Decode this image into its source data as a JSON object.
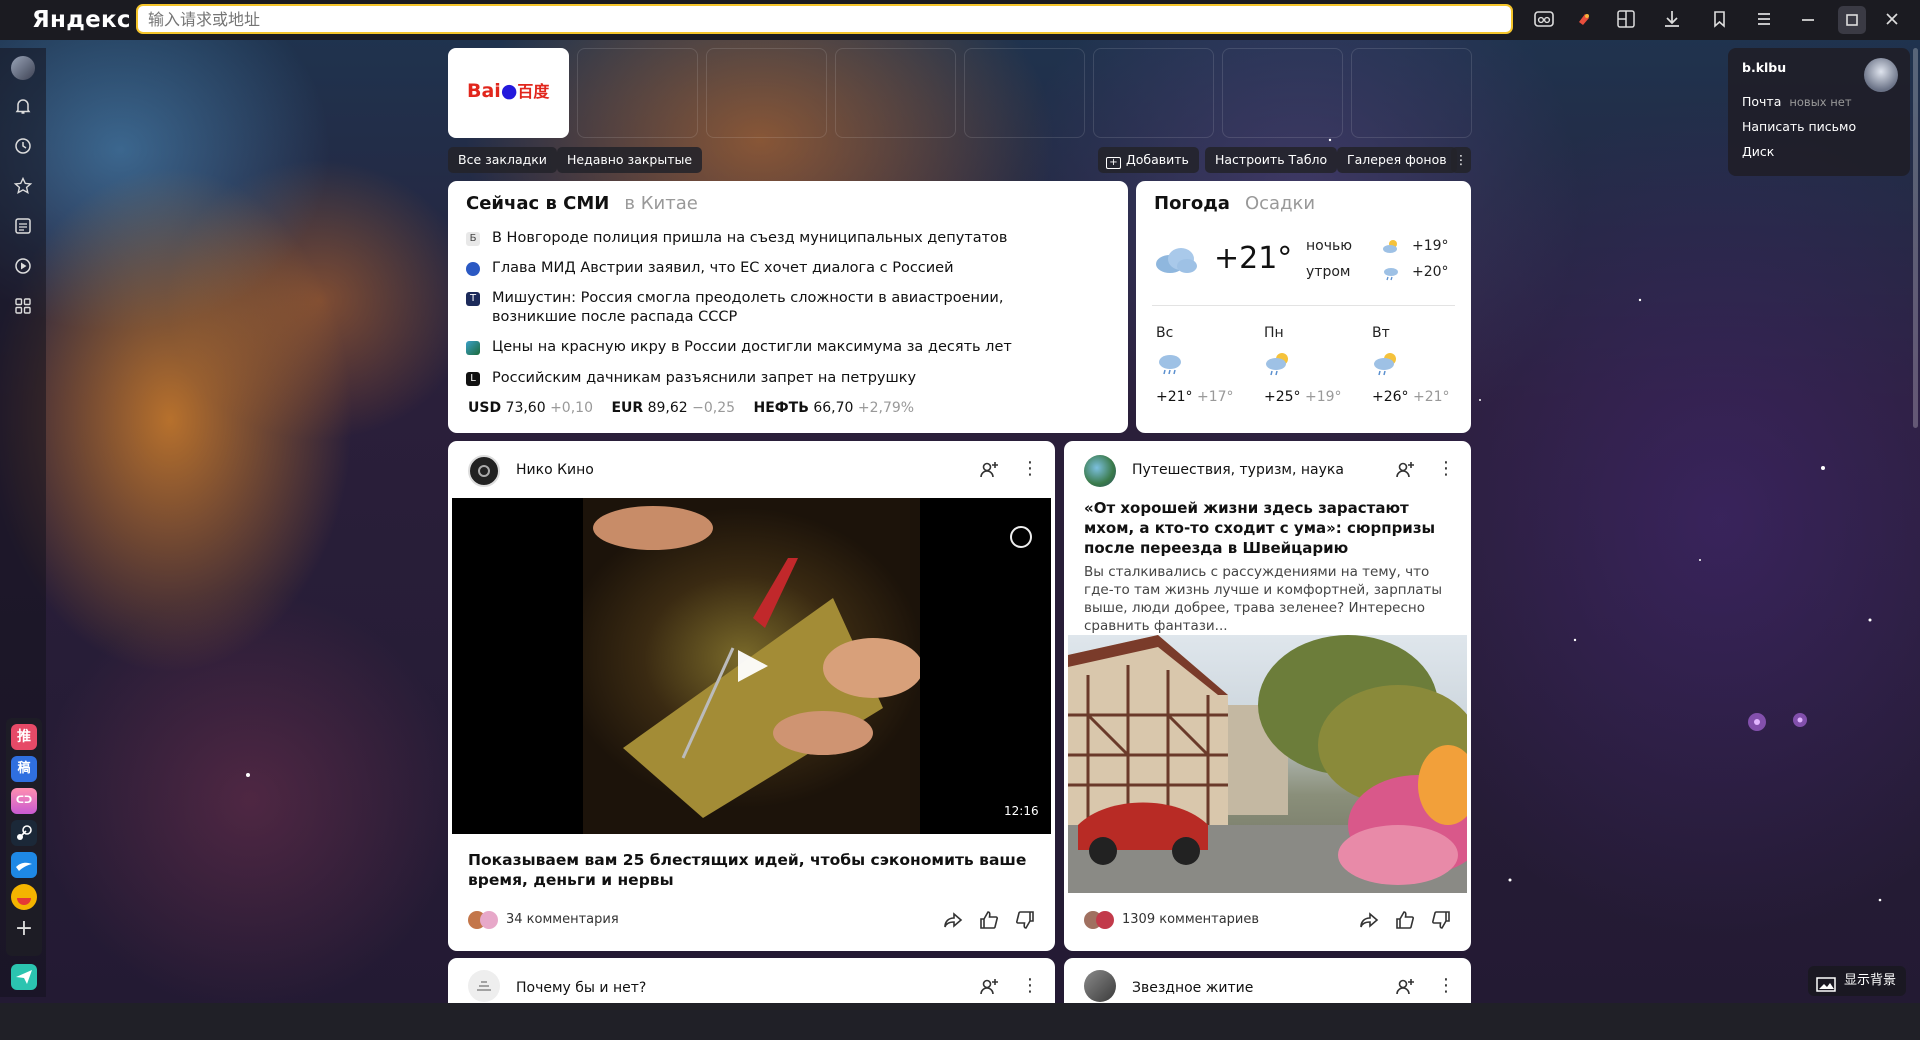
{
  "browser": {
    "logo": "Яндекс",
    "address_placeholder": "输入请求或地址"
  },
  "tablo": {
    "bookmarks_label": "Все закладки",
    "recent_label": "Недавно закрытые",
    "add_label": "Добавить",
    "setup_label": "Настроить Табло",
    "gallery_label": "Галерея фонов",
    "tiles": [
      {
        "name": "Baidu",
        "logo_left": "Bai",
        "logo_right": "百度"
      }
    ]
  },
  "news": {
    "title": "Сейчас в СМИ",
    "region": "в Китае",
    "items": [
      "В Новгороде полиция пришла на съезд муниципальных депутатов",
      "Глава МИД Австрии заявил, что ЕС хочет диалога с Россией",
      "Мишустин: Россия смогла преодолеть сложности в авиастроении, возникшие после распада СССР",
      "Цены на красную икру в России достигли максимума за десять лет",
      "Российским дачникам разъяснили запрет на петрушку"
    ],
    "rates": {
      "usd_label": "USD",
      "usd_value": "73,60",
      "usd_change": "+0,10",
      "eur_label": "EUR",
      "eur_value": "89,62",
      "eur_change": "−0,25",
      "oil_label": "НЕФТЬ",
      "oil_value": "66,70",
      "oil_change": "+2,79%"
    }
  },
  "weather": {
    "title": "Погода",
    "tab2": "Осадки",
    "now_temp": "+21°",
    "night_label": "ночью",
    "night_temp": "+19°",
    "morning_label": "утром",
    "morning_temp": "+20°",
    "days": [
      {
        "name": "Вс",
        "hi": "+21°",
        "lo": "+17°"
      },
      {
        "name": "Пн",
        "hi": "+25°",
        "lo": "+19°"
      },
      {
        "name": "Вт",
        "hi": "+26°",
        "lo": "+21°"
      }
    ]
  },
  "feed": [
    {
      "channel": "Нико Кино",
      "duration": "12:16",
      "title": "Показываем вам 25 блестящих идей, чтобы сэкономить ваше время, деньги и нервы",
      "comments": "34 комментария"
    },
    {
      "channel": "Путешествия, туризм, наука",
      "title": "«От хорошей жизни здесь зарастают мхом, а кто-то сходит с ума»: сюрпризы после переезда в Швейцарию",
      "snippet": "Вы сталкивались с рассуждениями на тему, что где-то там жизнь лучше и комфортней, зарплаты выше, люди добрее, трава зеленее? Интересно сравнить фантази...",
      "comments": "1309 комментариев"
    },
    {
      "channel": "Почему бы и нет?"
    },
    {
      "channel": "Звездное житие"
    }
  ],
  "account": {
    "username": "b.klbu",
    "mail_label": "Почта",
    "mail_status": "новых нет",
    "compose_label": "Написать письмо",
    "disk_label": "Диск"
  },
  "show_background": "显示背景"
}
